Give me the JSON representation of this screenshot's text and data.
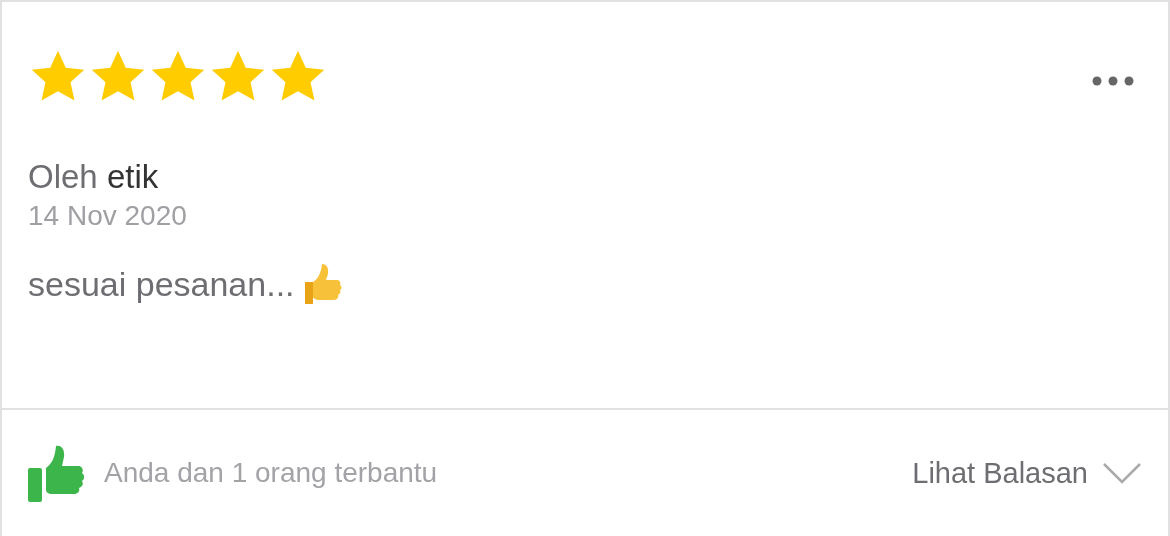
{
  "review": {
    "stars": 5,
    "author": "Oleh **etik**",
    "date": "14 Nov 2020",
    "text": "sesuai pesanan..."
  },
  "footer": {
    "liked": true,
    "helpful": "Anda dan 1 orang terbantu",
    "replies_link": "Lihat Balasan"
  }
}
